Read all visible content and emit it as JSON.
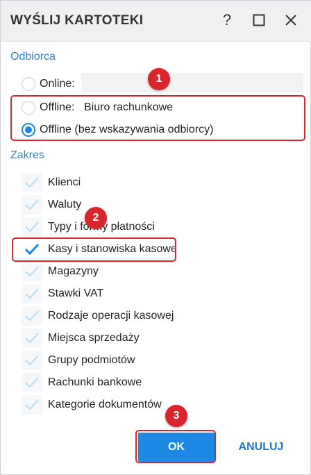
{
  "window": {
    "title": "WYŚLIJ KARTOTEKI",
    "help_label": "?"
  },
  "recipient": {
    "section_label": "Odbiorca",
    "options": [
      {
        "label": "Online:",
        "value": "",
        "checked": false
      },
      {
        "label": "Offline:",
        "value": "Biuro rachunkowe",
        "checked": false
      },
      {
        "label": "Offline (bez wskazywania odbiorcy)",
        "checked": true
      }
    ]
  },
  "scope": {
    "section_label": "Zakres",
    "items": [
      {
        "label": "Klienci",
        "checked": false
      },
      {
        "label": "Waluty",
        "checked": false
      },
      {
        "label": "Typy i formy płatności",
        "checked": false
      },
      {
        "label": "Kasy i stanowiska kasowe",
        "checked": true
      },
      {
        "label": "Magazyny",
        "checked": false
      },
      {
        "label": "Stawki VAT",
        "checked": false
      },
      {
        "label": "Rodzaje operacji kasowej",
        "checked": false
      },
      {
        "label": "Miejsca sprzedaży",
        "checked": false
      },
      {
        "label": "Grupy podmiotów",
        "checked": false
      },
      {
        "label": "Rachunki bankowe",
        "checked": false
      },
      {
        "label": "Kategorie dokumentów",
        "checked": false
      }
    ]
  },
  "annotations": {
    "badges": [
      "1",
      "2",
      "3"
    ],
    "color": "#d9252b"
  },
  "buttons": {
    "ok_label": "OK",
    "cancel_label": "ANULUJ"
  },
  "colors": {
    "accent": "#1e88e5",
    "section_label": "#2e86c1",
    "check_unchecked": "#b8ddf3",
    "check_checked": "#1e88e5"
  }
}
